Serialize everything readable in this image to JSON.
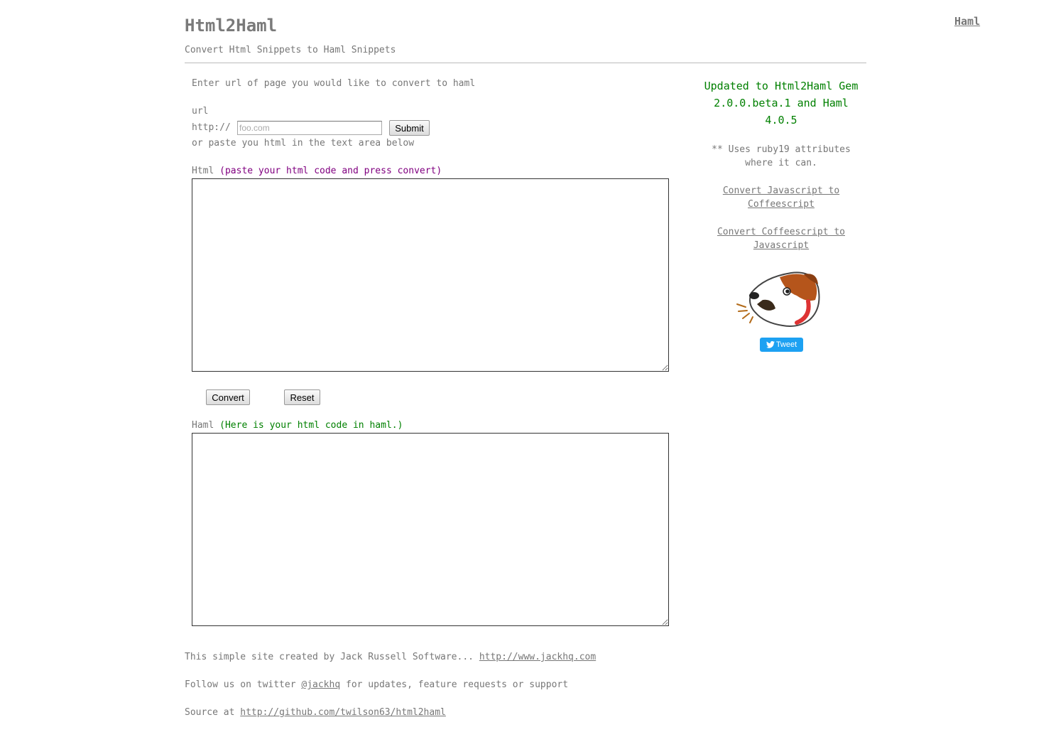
{
  "header": {
    "top_link": "Haml",
    "title": "Html2Haml",
    "subtitle": "Convert Html Snippets to Haml Snippets"
  },
  "url_form": {
    "intro": "Enter url of page you would like to convert to haml",
    "label": "url",
    "prefix": "http://",
    "placeholder": "foo.com",
    "value": "",
    "submit_label": "Submit",
    "or_text": "or paste you html in the text area below"
  },
  "html_box": {
    "label": "Html",
    "hint": "(paste your html code and press convert)",
    "value": ""
  },
  "actions": {
    "convert_label": "Convert",
    "reset_label": "Reset"
  },
  "haml_box": {
    "label": "Haml",
    "hint": "(Here is your html code in haml.)",
    "value": ""
  },
  "sidebar": {
    "update_line1": "Updated to Html2Haml Gem",
    "update_line2": "2.0.0.beta.1 and Haml",
    "update_line3": "4.0.5",
    "ruby_line1": "** Uses ruby19 attributes",
    "ruby_line2": "where it can.",
    "link1_line1": "Convert Javascript to",
    "link1_line2": "Coffeescript",
    "link2_line1": "Convert Coffeescript to",
    "link2_line2": "Javascript",
    "logo_icon": "jack-russell-dog-logo",
    "tweet_label": "Tweet"
  },
  "footer": {
    "line1_text": "This simple site created by Jack Russell Software... ",
    "line1_link": "http://www.jackhq.com",
    "line2_pre": "Follow us on twitter ",
    "line2_link": "@jackhq",
    "line2_post": " for updates, feature requests or support",
    "line3_text": "Source at ",
    "line3_link": "http://github.com/twilson63/html2haml"
  },
  "colors": {
    "accent_green": "#008000",
    "hint_purple": "#800080",
    "text_gray": "#777777",
    "tweet_blue": "#1da1f2"
  }
}
